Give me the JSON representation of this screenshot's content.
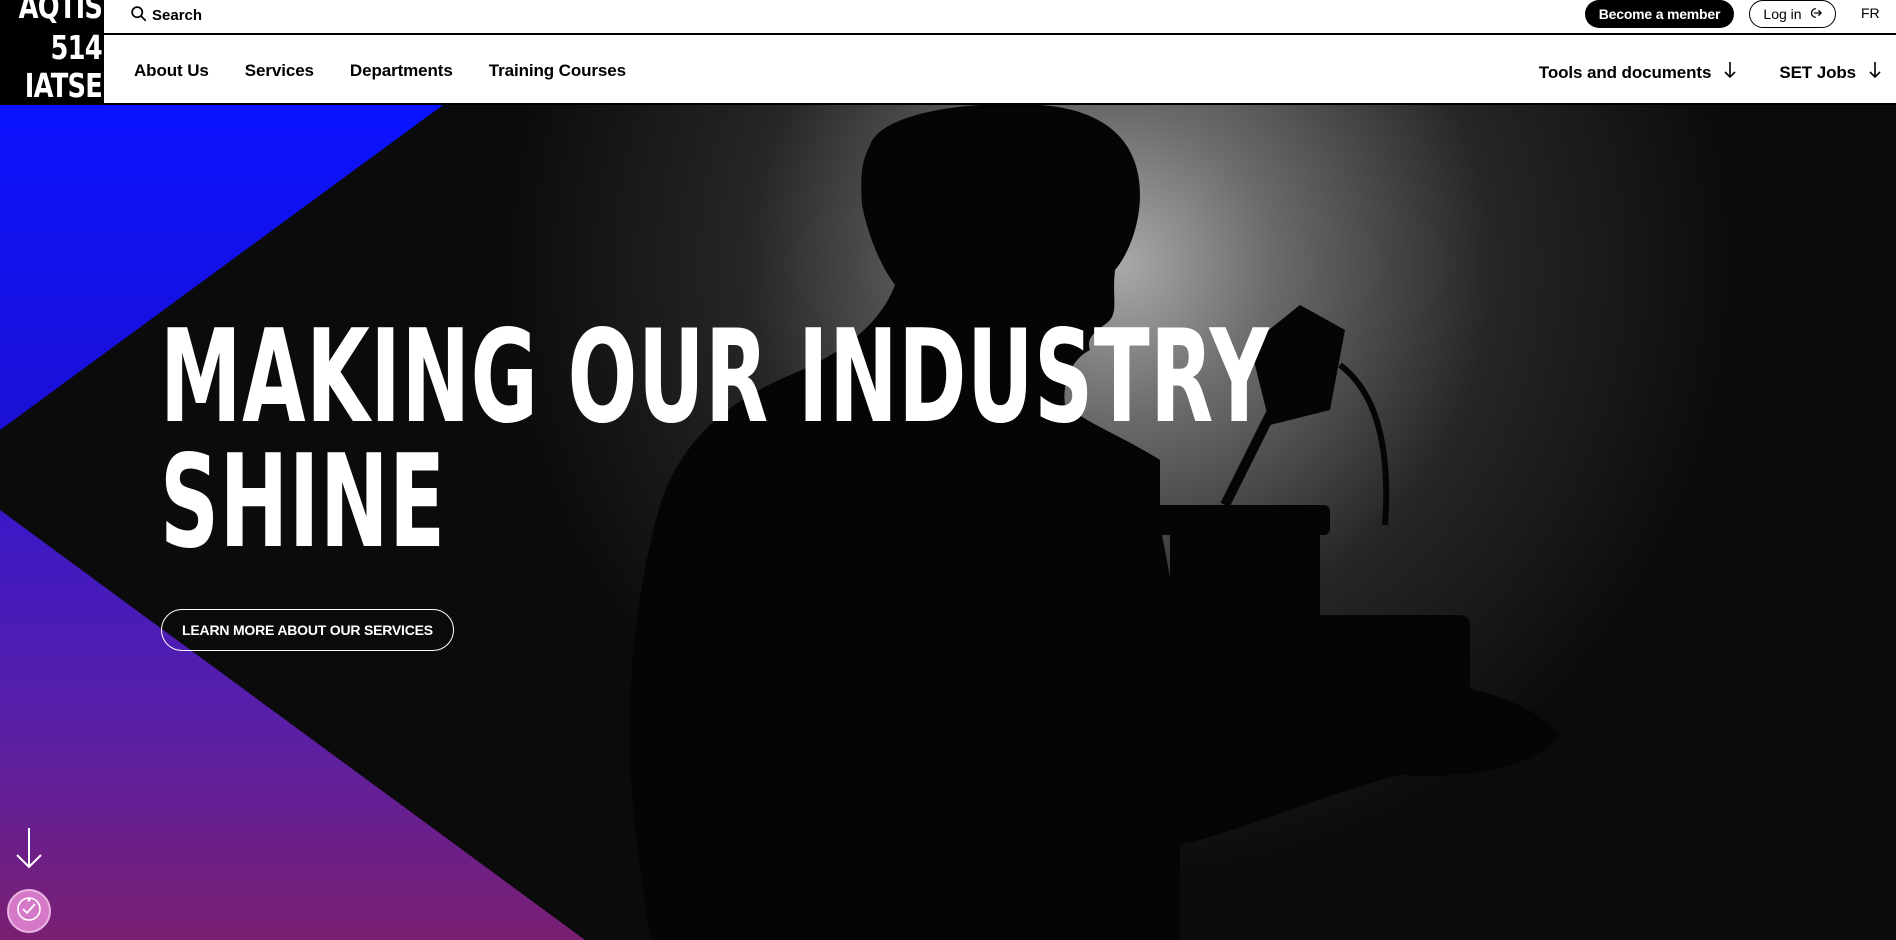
{
  "logo": {
    "line1": "AQTIS",
    "line2": "514",
    "line3": "IATSE"
  },
  "topbar": {
    "search_label": "Search",
    "become_member": "Become a member",
    "login": "Log in",
    "language": "FR"
  },
  "nav": {
    "left": [
      {
        "label": "About Us"
      },
      {
        "label": "Services"
      },
      {
        "label": "Departments"
      },
      {
        "label": "Training Courses"
      }
    ],
    "right": [
      {
        "label": "Tools and documents"
      },
      {
        "label": "SET Jobs"
      }
    ]
  },
  "hero": {
    "headline_line1": "MAKING OUR INDUSTRY",
    "headline_line2": "SHINE",
    "cta": "LEARN MORE ABOUT OUR SERVICES"
  },
  "icons": {
    "search": "search-icon",
    "login": "login-icon",
    "dropdown": "arrow-down-icon",
    "scroll": "scroll-down-icon",
    "accessibility": "accessibility-icon"
  },
  "colors": {
    "accent_blue": "#0a12ff",
    "accent_purple": "#5a1fa6",
    "accent_magenta": "#7a1f72",
    "background": "#0a0a0a"
  }
}
